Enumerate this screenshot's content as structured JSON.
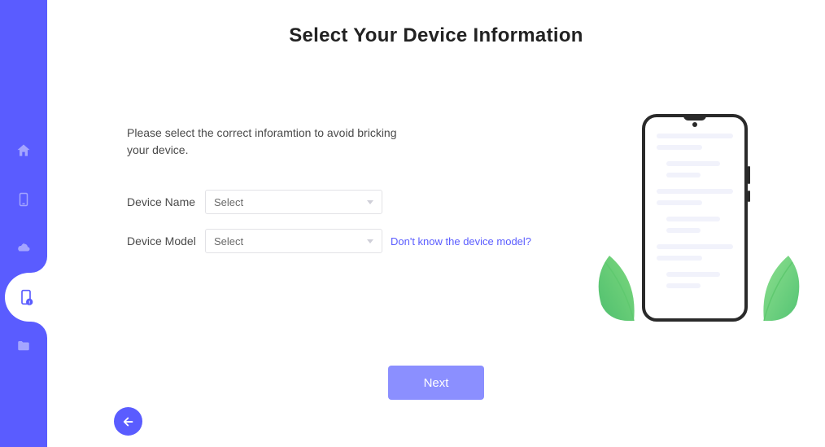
{
  "page": {
    "title": "Select Your Device Information",
    "instruction": "Please select the correct inforamtion to avoid bricking your device."
  },
  "form": {
    "name_label": "Device Name",
    "name_value": "Select",
    "model_label": "Device Model",
    "model_value": "Select",
    "help_link": "Don't know the device model?"
  },
  "actions": {
    "next": "Next"
  },
  "sidebar": {
    "items": [
      {
        "id": "home",
        "active": false
      },
      {
        "id": "phone",
        "active": false
      },
      {
        "id": "cloud",
        "active": false
      },
      {
        "id": "phone-alert",
        "active": true
      },
      {
        "id": "folder",
        "active": false
      }
    ]
  }
}
